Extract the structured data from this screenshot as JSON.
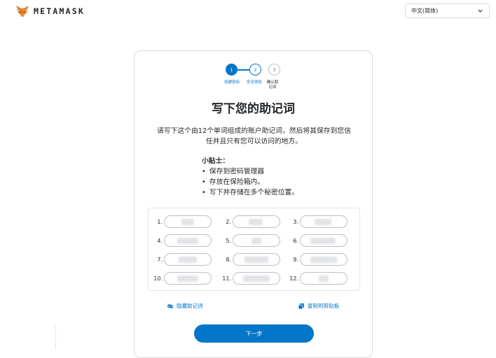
{
  "header": {
    "brand": "METAMASK",
    "logo_icon": "fox-icon",
    "language": "中文(简体)",
    "language_icon": "chevron-down-icon"
  },
  "stepper": {
    "steps": [
      {
        "number": "1",
        "label": "创建密码",
        "state": "completed"
      },
      {
        "number": "2",
        "label": "安全钱包",
        "state": "current"
      },
      {
        "number": "3",
        "label": "确认助记词",
        "state": "upcoming"
      }
    ]
  },
  "main": {
    "title": "写下您的助记词",
    "description": "请写下这个由12个单词组成的账户助记词，然后将其保存到您信任并且只有您可以访问的地方。",
    "tips_title": "小贴士：",
    "tips": [
      "保存到密码管理器",
      "存放在保险箱内。",
      "写下并存储在多个秘密位置。"
    ]
  },
  "phrase": {
    "words": [
      {
        "index": "1."
      },
      {
        "index": "2."
      },
      {
        "index": "3."
      },
      {
        "index": "4."
      },
      {
        "index": "5."
      },
      {
        "index": "6."
      },
      {
        "index": "7."
      },
      {
        "index": "8."
      },
      {
        "index": "9."
      },
      {
        "index": "10."
      },
      {
        "index": "11."
      },
      {
        "index": "12."
      }
    ]
  },
  "actions": {
    "hide_label": "隐藏助记词",
    "hide_icon": "eye-slash-icon",
    "copy_label": "复制到剪贴板",
    "copy_icon": "copy-icon",
    "next_label": "下一步"
  },
  "colors": {
    "accent": "#0376c9",
    "border": "#d6d9dc",
    "text": "#24272a"
  }
}
